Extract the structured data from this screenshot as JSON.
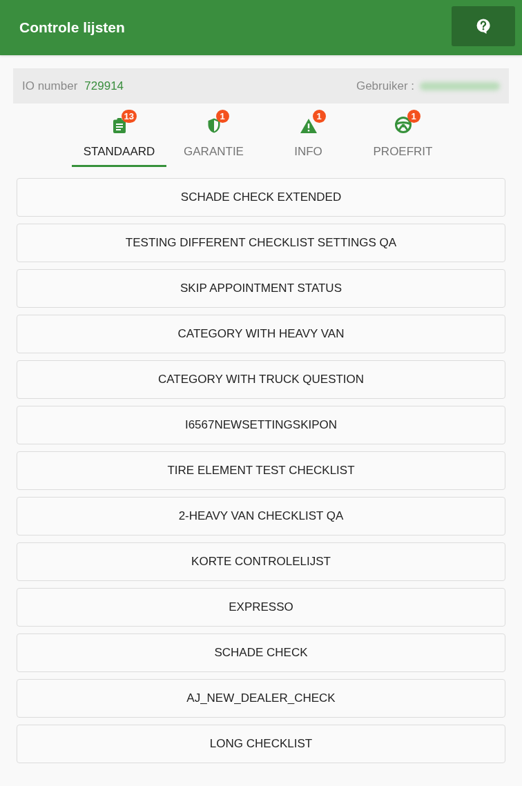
{
  "header": {
    "title": "Controle lijsten"
  },
  "info_bar": {
    "io_label": "IO number",
    "io_number": "729914",
    "user_label": "Gebruiker :"
  },
  "tabs": [
    {
      "label": "STANDAARD",
      "badge": "13",
      "selected": true
    },
    {
      "label": "GARANTIE",
      "badge": "1",
      "selected": false
    },
    {
      "label": "INFO",
      "badge": "1",
      "selected": false
    },
    {
      "label": "PROEFRIT",
      "badge": "1",
      "selected": false
    }
  ],
  "checklists": [
    "SCHADE CHECK EXTENDED",
    "TESTING DIFFERENT CHECKLIST SETTINGS QA",
    "SKIP APPOINTMENT STATUS",
    "CATEGORY WITH HEAVY VAN",
    "CATEGORY WITH TRUCK QUESTION",
    "I6567NEWSETTINGSKIPON",
    "TIRE ELEMENT TEST CHECKLIST",
    "2-HEAVY VAN CHECKLIST QA",
    "KORTE CONTROLELIJST",
    "EXPRESSO",
    "SCHADE CHECK",
    "AJ_NEW_DEALER_CHECK",
    "LONG CHECKLIST"
  ]
}
